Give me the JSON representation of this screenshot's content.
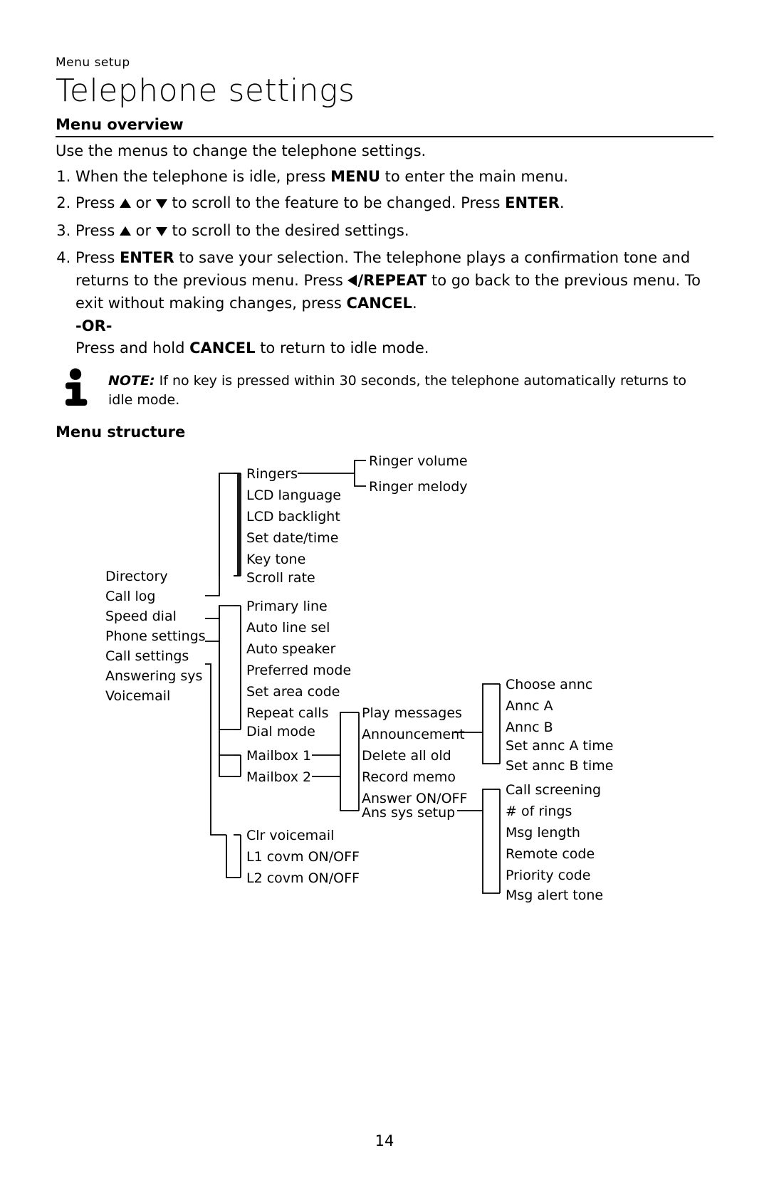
{
  "header_small": "Menu setup",
  "title": "Telephone settings",
  "h_overview": "Menu overview",
  "intro": "Use the menus to change the telephone settings.",
  "steps": {
    "s1a": "When the telephone is idle, press ",
    "s1b": "MENU",
    "s1c": " to enter the main menu.",
    "s2a": "Press ",
    "s2b": " or ",
    "s2c": " to scroll to the feature to be changed. Press ",
    "s2d": "ENTER",
    "s2e": ".",
    "s3a": "Press ",
    "s3b": " or ",
    "s3c": " to scroll to the desired settings.",
    "s4a": "Press ",
    "s4b": "ENTER",
    "s4c": " to save your selection. The telephone plays a confirmation tone and returns to the previous menu. Press ",
    "s4d": "/REPEAT",
    "s4e": " to go back to the previous menu. To exit without making changes, press ",
    "s4f": "CANCEL",
    "s4g": ".",
    "or": "-OR-",
    "s5a": "Press and hold ",
    "s5b": "CANCEL",
    "s5c": " to return to idle mode."
  },
  "note_lead": "NOTE:",
  "note": " If no key is pressed within 30 seconds, the telephone automatically returns to idle mode.",
  "h_structure": "Menu structure",
  "page_num": "14",
  "tree": {
    "root": [
      "Directory",
      "Call log",
      "Speed dial",
      "Phone settings",
      "Call settings",
      "Answering sys",
      "Voicemail"
    ],
    "phone_settings": [
      "Ringers",
      "LCD language",
      "LCD backlight",
      "Set date/time",
      "Key tone",
      "Scroll rate"
    ],
    "ringers": [
      "Ringer volume",
      "Ringer melody"
    ],
    "call_settings": [
      "Primary line",
      "Auto line sel",
      "Auto speaker",
      "Preferred mode",
      "Set area code",
      "Repeat calls",
      "Dial mode"
    ],
    "answering_sys": [
      "Mailbox 1",
      "Mailbox 2"
    ],
    "mailbox": [
      "Play messages",
      "Announcement",
      "Delete all old",
      "Record memo",
      "Answer ON/OFF",
      "Ans sys setup"
    ],
    "announcement": [
      "Choose annc",
      "Annc A",
      "Annc B",
      "Set annc A time",
      "Set annc B time"
    ],
    "ans_sys_setup": [
      "Call screening",
      "# of rings",
      "Msg length",
      "Remote code",
      "Priority code",
      "Msg alert tone"
    ],
    "voicemail": [
      "Clr voicemail",
      "L1 covm ON/OFF",
      "L2 covm ON/OFF"
    ]
  }
}
